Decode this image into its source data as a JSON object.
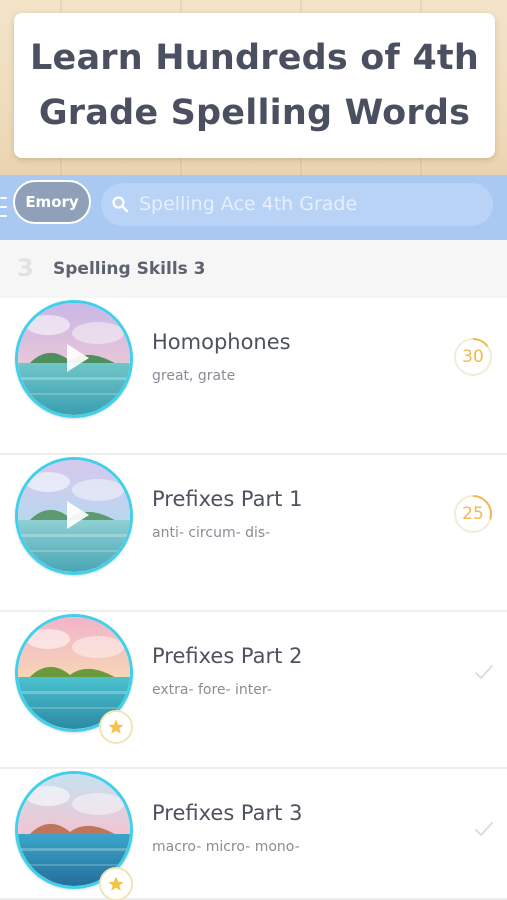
{
  "banner": {
    "title": "Learn Hundreds of 4th Grade Spelling Words"
  },
  "toolbar": {
    "user_name": "Emory",
    "search_placeholder": "Spelling Ace 4th Grade"
  },
  "section": {
    "number": "3",
    "title": "Spelling Skills 3"
  },
  "lessons": [
    {
      "title": "Homophones",
      "subtitle": "great, grate",
      "status": "count",
      "count": "30",
      "progress": 0.15,
      "thumb_overlay": "play-icon"
    },
    {
      "title": "Prefixes Part 1",
      "subtitle": "anti- circum- dis-",
      "status": "count",
      "count": "25",
      "progress": 0.3,
      "thumb_overlay": "play-icon"
    },
    {
      "title": "Prefixes Part 2",
      "subtitle": "extra- fore- inter-",
      "status": "complete",
      "thumb_overlay": "star-icon"
    },
    {
      "title": "Prefixes Part 3",
      "subtitle": "macro- micro- mono-",
      "status": "complete",
      "thumb_overlay": "star-icon"
    }
  ],
  "colors": {
    "toolbar": "#a9c9f2",
    "accent_ring": "#41d0ea",
    "count_color": "#f0b94d",
    "title_text": "#4a5060"
  }
}
